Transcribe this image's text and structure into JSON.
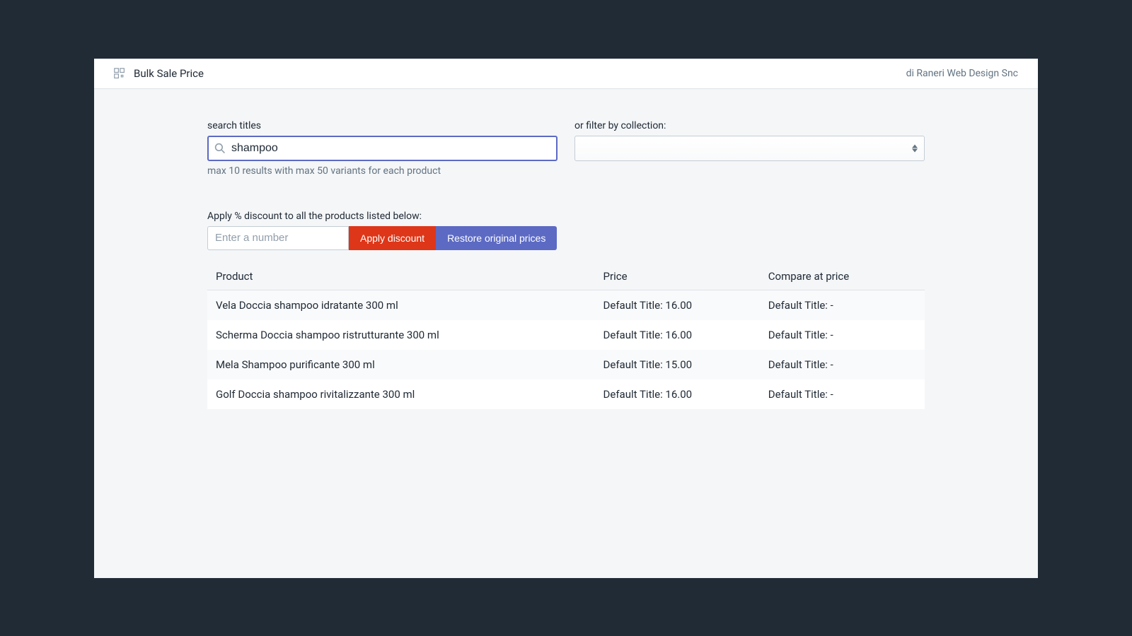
{
  "header": {
    "title": "Bulk Sale Price",
    "vendor": "di Raneri Web Design Snc"
  },
  "search": {
    "label": "search titles",
    "value": "shampoo",
    "helper": "max 10 results with max 50 variants for each product"
  },
  "collection_filter": {
    "label": "or filter by collection:",
    "value": ""
  },
  "discount": {
    "label": "Apply % discount to all the products listed below:",
    "placeholder": "Enter a number",
    "apply_button": "Apply discount",
    "restore_button": "Restore original prices"
  },
  "table_headers": {
    "product": "Product",
    "price": "Price",
    "compare": "Compare at price"
  },
  "products": [
    {
      "name": "Vela Doccia shampoo idratante 300 ml",
      "price": "Default Title: 16.00",
      "compare": "Default Title: -"
    },
    {
      "name": "Scherma Doccia shampoo ristrutturante 300 ml",
      "price": "Default Title: 16.00",
      "compare": "Default Title: -"
    },
    {
      "name": "Mela Shampoo purificante 300 ml",
      "price": "Default Title: 15.00",
      "compare": "Default Title: -"
    },
    {
      "name": "Golf Doccia shampoo rivitalizzante 300 ml",
      "price": "Default Title: 16.00",
      "compare": "Default Title: -"
    }
  ]
}
